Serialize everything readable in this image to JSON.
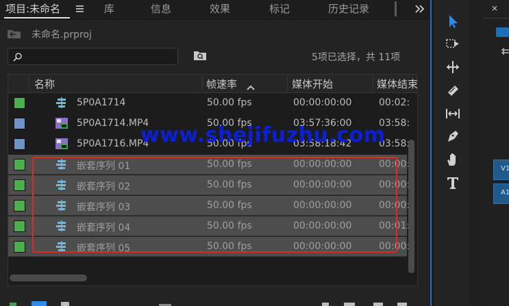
{
  "tabs": [
    {
      "label": "项目:未命名",
      "active": true
    },
    {
      "label": "库"
    },
    {
      "label": "信息"
    },
    {
      "label": "效果"
    },
    {
      "label": "标记"
    },
    {
      "label": "历史记录"
    }
  ],
  "tab_menu_icon": "hamburger-menu-icon",
  "overflow_icon": "double-chevron-right-icon",
  "project": {
    "file_name": "未命名.prproj"
  },
  "search": {
    "placeholder": "",
    "icon": "search-icon"
  },
  "new_bin_icon": "bin-icon",
  "selection_status": "5项已选择，共 11项",
  "columns": [
    {
      "label": "名称"
    },
    {
      "label": "帧速率",
      "sorted": "ascending"
    },
    {
      "label": "媒体开始"
    },
    {
      "label": "媒体结束"
    }
  ],
  "rows": [
    {
      "label_color": "#4cae4c",
      "icon": "sequence-icon",
      "name": "5P0A1714",
      "fps": "50.00 fps",
      "start": "00:00:00:00",
      "end": "00:02:",
      "selected": false
    },
    {
      "label_color": "#6f93c6",
      "icon": "video-clip-icon",
      "name": "5P0A1714.MP4",
      "fps": "50.00 fps",
      "start": "03:57:36:00",
      "end": "03:58:",
      "selected": false
    },
    {
      "label_color": "#6f93c6",
      "icon": "video-clip-icon",
      "name": "5P0A1716.MP4",
      "fps": "50.00 fps",
      "start": "03:58:18:42",
      "end": "03:58:",
      "selected": false
    },
    {
      "label_color": "#4cae4c",
      "icon": "sequence-icon",
      "name": "嵌套序列 01",
      "fps": "50.00 fps",
      "start": "00:00:00:00",
      "end": "00:00:",
      "selected": true
    },
    {
      "label_color": "#4cae4c",
      "icon": "sequence-icon",
      "name": "嵌套序列 02",
      "fps": "50.00 fps",
      "start": "00:00:00:00",
      "end": "00:00:",
      "selected": true
    },
    {
      "label_color": "#4cae4c",
      "icon": "sequence-icon",
      "name": "嵌套序列 03",
      "fps": "50.00 fps",
      "start": "00:00:00:00",
      "end": "00:00:",
      "selected": true
    },
    {
      "label_color": "#4cae4c",
      "icon": "sequence-icon",
      "name": "嵌套序列 04",
      "fps": "50.00 fps",
      "start": "00:00:00:00",
      "end": "00:01:",
      "selected": true
    },
    {
      "label_color": "#4cae4c",
      "icon": "sequence-icon",
      "name": "嵌套序列 05",
      "fps": "50.00 fps",
      "start": "00:00:00:00",
      "end": "00:00:",
      "selected": true
    }
  ],
  "tools": [
    "selection-tool-icon",
    "track-select-tool-icon",
    "ripple-edit-tool-icon",
    "razor-tool-icon",
    "slip-tool-icon",
    "pen-tool-icon",
    "hand-tool-icon",
    "type-tool-icon"
  ],
  "right_panel": {
    "close_label": "×",
    "track_v1": "V1",
    "track_a1": "A1"
  },
  "watermark": "www.shejifuzhu.com",
  "colors": {
    "accent": "#2d8ceb",
    "selection_box": "#e0281f",
    "green_label": "#4cae4c",
    "blue_label": "#6f93c6"
  }
}
